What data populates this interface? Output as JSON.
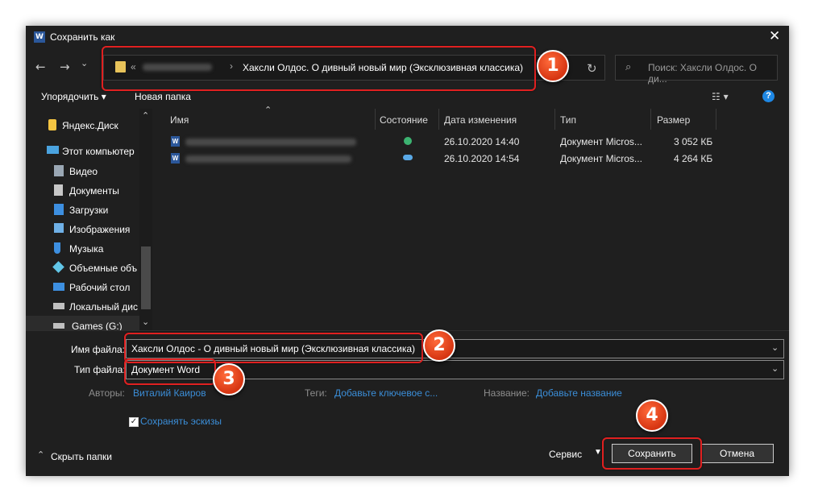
{
  "window": {
    "title": "Сохранить как",
    "app_icon": "word-icon",
    "close_glyph": "✕"
  },
  "nav": {
    "back": "←",
    "forward": "→",
    "recent": "⌄",
    "up": "↑"
  },
  "address": {
    "prefix": "«",
    "separator": "›",
    "current_folder": "Хаксли Олдос. О дивный новый мир (Эксклюзивная классика)",
    "refresh": "↻"
  },
  "search": {
    "placeholder": "Поиск: Хаксли Олдос. О ди...",
    "icon": "⌕"
  },
  "toolbar": {
    "organize": "Упорядочить ▾",
    "new_folder": "Новая папка",
    "view": "☷ ▾",
    "help": "?"
  },
  "sidebar": {
    "items": [
      {
        "label": "Яндекс.Диск",
        "icon": "yandex-disk-icon",
        "color": "#f4c542"
      },
      {
        "label": "Этот компьютер",
        "icon": "computer-icon",
        "color": "#4aa3df"
      },
      {
        "label": "Видео",
        "icon": "video-icon",
        "color": "#9aa7b4"
      },
      {
        "label": "Документы",
        "icon": "documents-icon",
        "color": "#c7c7c7"
      },
      {
        "label": "Загрузки",
        "icon": "downloads-icon",
        "color": "#3d8fe0"
      },
      {
        "label": "Изображения",
        "icon": "pictures-icon",
        "color": "#6fb0e6"
      },
      {
        "label": "Музыка",
        "icon": "music-icon",
        "color": "#3d8fe0"
      },
      {
        "label": "Объемные объ",
        "icon": "3d-objects-icon",
        "color": "#62c6e8"
      },
      {
        "label": "Рабочий стол",
        "icon": "desktop-icon",
        "color": "#3d8fe0"
      },
      {
        "label": "Локальный дис",
        "icon": "local-disk-icon",
        "color": "#c0c0c0"
      },
      {
        "label": "Games (G:)",
        "icon": "drive-icon",
        "color": "#c0c0c0"
      }
    ]
  },
  "columns": {
    "name": "Имя",
    "status": "Состояние",
    "modified": "Дата изменения",
    "type": "Тип",
    "size": "Размер"
  },
  "files": [
    {
      "date": "26.10.2020 14:40",
      "type": "Документ Micros...",
      "size": "3 052 КБ",
      "status_icon": "synced-check-icon"
    },
    {
      "date": "26.10.2020 14:54",
      "type": "Документ Micros...",
      "size": "4 264 КБ",
      "status_icon": "cloud-icon"
    }
  ],
  "form": {
    "filename_label": "Имя файла:",
    "filename_value": "Хаксли Олдос - О дивный новый мир (Эксклюзивная классика)",
    "filetype_label": "Тип файла:",
    "filetype_value": "Документ Word",
    "authors_label": "Авторы:",
    "authors_value": "Виталий Каиров",
    "tags_label": "Теги:",
    "tags_value": "Добавьте ключевое с...",
    "title_label": "Название:",
    "title_value": "Добавьте название",
    "thumbnails_label": "Сохранять эскизы",
    "thumbnails_checked": true
  },
  "footer": {
    "hide_folders": "Скрыть папки",
    "service": "Сервис",
    "save": "Сохранить",
    "cancel": "Отмена"
  },
  "callouts": [
    "1",
    "2",
    "3",
    "4"
  ],
  "colors": {
    "dialog_bg": "#1f1f1f",
    "accent_link": "#3b8ed8",
    "callout_red": "#e02020",
    "badge_orange": "#e8471c"
  }
}
